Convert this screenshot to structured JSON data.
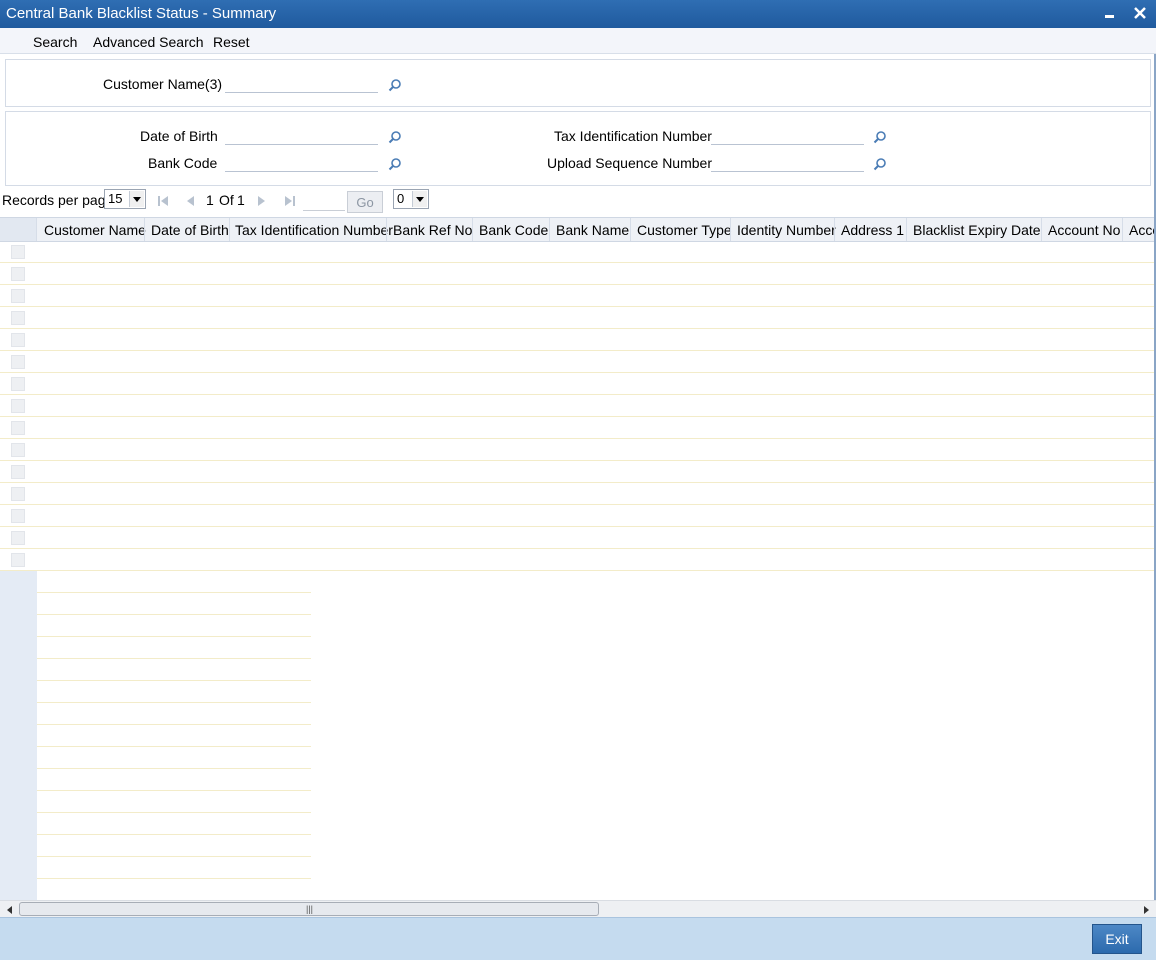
{
  "window": {
    "title": "Central Bank Blacklist Status - Summary"
  },
  "menu": {
    "search": "Search",
    "advanced_search": "Advanced Search",
    "reset": "Reset"
  },
  "criteria": {
    "customer_name_label": "Customer Name(3)",
    "customer_name_value": "",
    "date_of_birth_label": "Date of Birth",
    "date_of_birth_value": "",
    "bank_code_label": "Bank Code",
    "bank_code_value": "",
    "tax_id_label": "Tax Identification Number",
    "tax_id_value": "",
    "upload_seq_label": "Upload Sequence Number",
    "upload_seq_value": ""
  },
  "pager": {
    "records_per_page_label": "Records per page",
    "records_per_page_value": "15",
    "current_page": "1",
    "of_label": "Of",
    "total_pages": "1",
    "go_label": "Go",
    "extra_select_value": "0"
  },
  "grid": {
    "columns": [
      "Customer Name",
      "Date of Birth",
      "Tax Identification Number",
      "Bank Ref No",
      "Bank Code",
      "Bank Name",
      "Customer Type",
      "Identity Number",
      "Address 1",
      "Blacklist Expiry Date",
      "Account No",
      "Acco"
    ],
    "rows": []
  },
  "footer": {
    "exit_label": "Exit"
  },
  "colors": {
    "titlebar": "#2f6eb3",
    "footer": "#c5dbef",
    "row_line": "#f3ecc9"
  }
}
